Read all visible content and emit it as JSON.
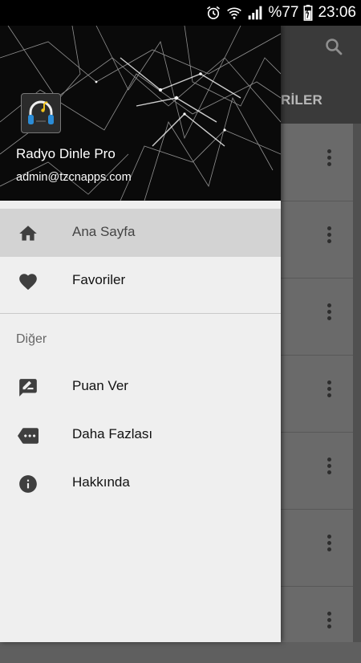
{
  "status_bar": {
    "battery": "%77",
    "time": "23:06",
    "icons": [
      "alarm-icon",
      "wifi-icon",
      "signal-icon",
      "battery-icon"
    ]
  },
  "app": {
    "tab_partial": "RİLER",
    "search_icon": "search-icon",
    "row_count": 7
  },
  "drawer": {
    "header": {
      "app_name": "Radyo Dinle Pro",
      "email": "admin@tzcnapps.com",
      "logo_icon": "headphones-icon"
    },
    "primary_items": [
      {
        "label": "Ana Sayfa",
        "icon": "home-icon",
        "selected": true
      },
      {
        "label": "Favoriler",
        "icon": "heart-icon",
        "selected": false
      }
    ],
    "section_header": "Diğer",
    "secondary_items": [
      {
        "label": "Puan Ver",
        "icon": "rate-review-icon"
      },
      {
        "label": "Daha Fazlası",
        "icon": "more-label-icon"
      },
      {
        "label": "Hakkında",
        "icon": "info-icon"
      }
    ]
  },
  "colors": {
    "drawer_bg": "#efefef",
    "selected_bg": "#d3d3d3",
    "icon": "#3f3f3f",
    "status_bar": "#000000"
  }
}
